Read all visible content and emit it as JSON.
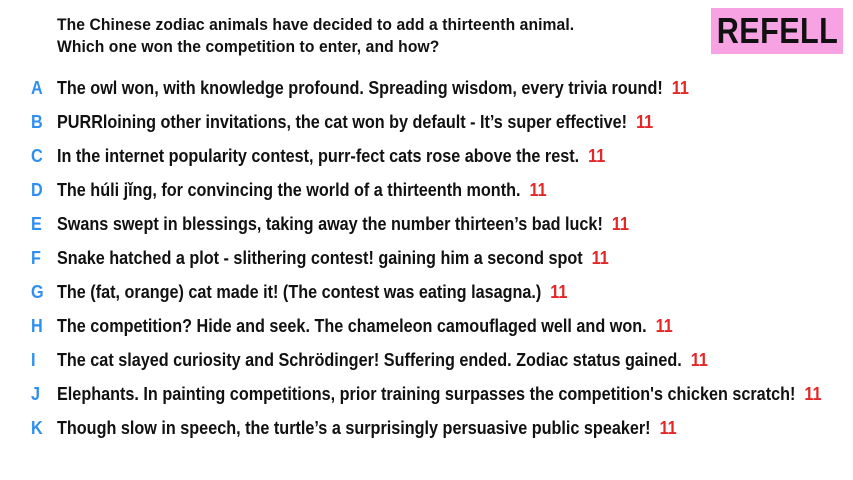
{
  "question": {
    "line1": "The Chinese zodiac animals have decided to add a thirteenth animal.",
    "line2": "Which one won the competition to enter, and how?"
  },
  "badge": {
    "label": "REFELL",
    "color": "#f7a3e3"
  },
  "colors": {
    "letter": "#2f8ff0",
    "score": "#e32626"
  },
  "answers": [
    {
      "letter": "A",
      "text": "The owl won, with knowledge profound. Spreading wisdom, every trivia round!",
      "score": "11"
    },
    {
      "letter": "B",
      "text": "PURRloining other invitations, the cat won by default - It’s super effective!",
      "score": "11"
    },
    {
      "letter": "C",
      "text": "In the internet popularity contest, purr-fect cats rose above the rest.",
      "score": "11"
    },
    {
      "letter": "D",
      "text": "The húli jǐng, for convincing the world of a thirteenth month.",
      "score": "11"
    },
    {
      "letter": "E",
      "text": "Swans swept in blessings, taking away the number thirteen’s bad luck!",
      "score": "11"
    },
    {
      "letter": "F",
      "text": "Snake hatched a plot - slithering contest! gaining him a second spot",
      "score": "11"
    },
    {
      "letter": "G",
      "text": "The (fat, orange) cat made it! (The contest was eating lasagna.)",
      "score": "11"
    },
    {
      "letter": "H",
      "text": "The competition? Hide and seek. The chameleon camouflaged well and won.",
      "score": "11"
    },
    {
      "letter": "I",
      "text": "The cat slayed curiosity and Schrödinger! Suffering ended. Zodiac status gained.",
      "score": "11"
    },
    {
      "letter": "J",
      "text": "Elephants. In painting competitions, prior training surpasses the competition's chicken scratch!",
      "score": "11"
    },
    {
      "letter": "K",
      "text": "Though slow in speech, the turtle’s a surprisingly persuasive public speaker!",
      "score": "11"
    }
  ]
}
